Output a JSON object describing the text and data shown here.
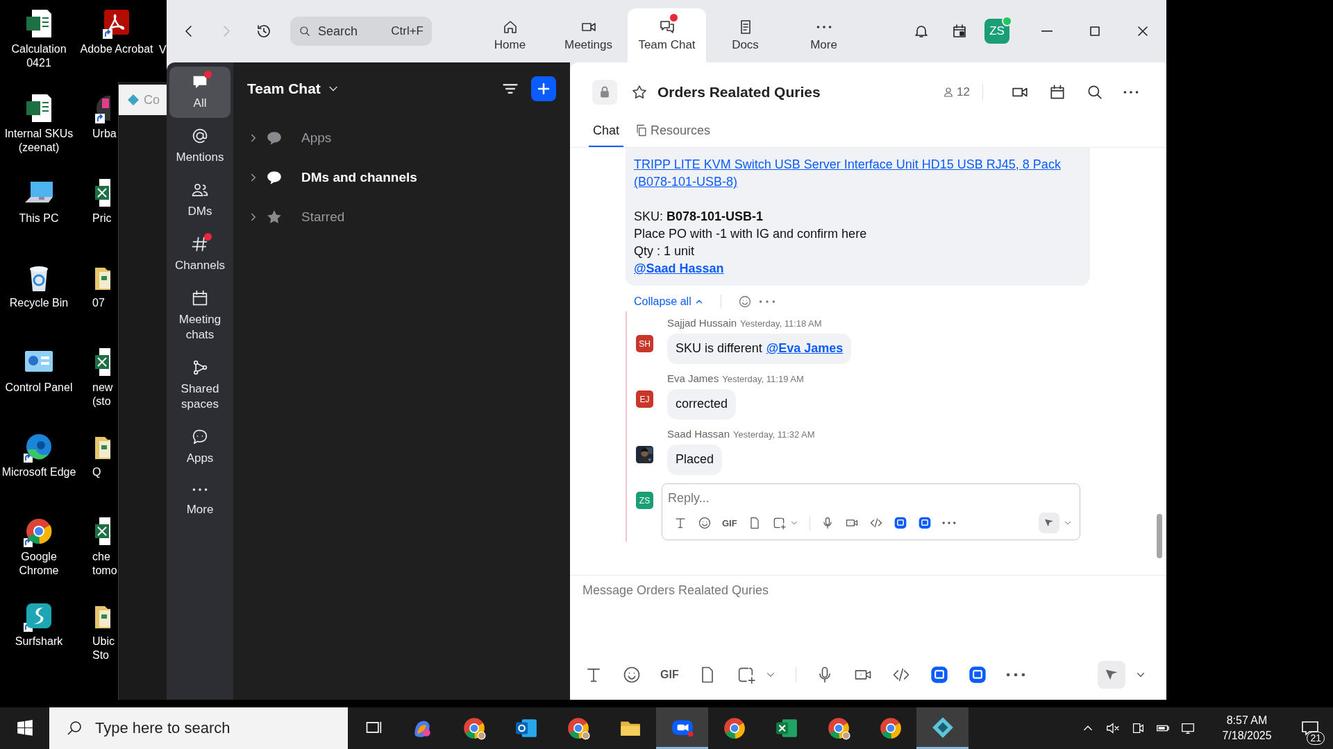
{
  "desktop": {
    "column_1": [
      {
        "label": "Calculation 0421",
        "kind": "spreadsheet",
        "shortcut": false
      },
      {
        "label": "Internal SKUs (zeenat)",
        "kind": "spreadsheet",
        "shortcut": false
      },
      {
        "label": "This PC",
        "kind": "computer",
        "shortcut": false
      },
      {
        "label": "Recycle Bin",
        "kind": "recycle-bin",
        "shortcut": false
      },
      {
        "label": "Control Panel",
        "kind": "control-panel",
        "shortcut": false
      },
      {
        "label": "Microsoft Edge",
        "kind": "edge",
        "shortcut": true
      },
      {
        "label": "Google Chrome",
        "kind": "chrome",
        "shortcut": true
      },
      {
        "label": "Surfshark",
        "kind": "surfshark",
        "shortcut": true
      }
    ],
    "column_2": [
      {
        "label": "Adobe Acrobat",
        "kind": "pdf",
        "shortcut": true,
        "cut": false
      },
      {
        "label": "Urba",
        "kind": "app",
        "shortcut": true,
        "cut": true
      },
      {
        "label": "Pric",
        "kind": "spreadsheet",
        "shortcut": false,
        "cut": true
      },
      {
        "label": "07",
        "kind": "folder",
        "shortcut": false,
        "cut": true
      },
      {
        "label": "new (sto",
        "kind": "spreadsheet",
        "shortcut": false,
        "cut": true
      },
      {
        "label": "Q",
        "kind": "folder",
        "shortcut": false,
        "cut": true
      },
      {
        "label": "che tomo",
        "kind": "spreadsheet",
        "shortcut": false,
        "cut": true
      },
      {
        "label": "Ubic Sto",
        "kind": "folder",
        "shortcut": false,
        "cut": true
      }
    ],
    "column_3_label": "V",
    "background_window": {
      "tab": "Co"
    }
  },
  "zoom": {
    "nav": {
      "forward_disabled": true
    },
    "search": {
      "placeholder": "Search",
      "shortcut": "Ctrl+F"
    },
    "tabs": [
      {
        "label": "Home",
        "selected": false,
        "badge": false
      },
      {
        "label": "Meetings",
        "selected": false,
        "badge": false
      },
      {
        "label": "Team Chat",
        "selected": true,
        "badge": true
      },
      {
        "label": "Docs",
        "selected": false,
        "badge": false
      },
      {
        "label": "More",
        "selected": false,
        "badge": false
      }
    ],
    "user": {
      "initials": "ZS",
      "online": true
    },
    "rail": [
      {
        "label": "All",
        "selected": true,
        "badge": true
      },
      {
        "label": "Mentions",
        "selected": false,
        "badge": false
      },
      {
        "label": "DMs",
        "selected": false,
        "badge": false
      },
      {
        "label": "Channels",
        "selected": false,
        "badge": true
      },
      {
        "label": "Meeting chats",
        "selected": false,
        "badge": false
      },
      {
        "label": "Shared spaces",
        "selected": false,
        "badge": false
      },
      {
        "label": "Apps",
        "selected": false,
        "badge": false
      },
      {
        "label": "More",
        "selected": false,
        "badge": false
      }
    ],
    "sidebar": {
      "title": "Team Chat",
      "sections": [
        {
          "label": "Apps",
          "expanded": false,
          "unread": false
        },
        {
          "label": "DMs and channels",
          "expanded": false,
          "unread": true
        },
        {
          "label": "Starred",
          "expanded": false,
          "unread": false
        }
      ]
    },
    "channel": {
      "title": "Orders Realated Quries",
      "locked": true,
      "starred": false,
      "members": "12",
      "tabs": [
        {
          "label": "Chat",
          "selected": true
        },
        {
          "label": "Resources",
          "selected": false
        }
      ]
    },
    "message": {
      "lines": [
        {
          "kind": "link",
          "text": "TRIPP LITE KVM Switch USB Server Interface Unit HD15 USB RJ45, 8 Pack (B078-101-USB-8)"
        },
        {
          "kind": "text",
          "text": "SKU: **B078-101-USB-1**"
        },
        {
          "kind": "text",
          "text": "Place PO with -1 with IG and confirm here"
        },
        {
          "kind": "text",
          "text": "Qty : 1 unit"
        },
        {
          "kind": "mention",
          "text": "@Saad Hassan"
        }
      ]
    },
    "thread": {
      "collapse_label": "Collapse all",
      "replies": [
        {
          "author": "Sajjad Hussain",
          "time": "Yesterday, 11:18 AM",
          "kind": "initials",
          "initials": "SH",
          "color": "#c9372c",
          "text": "SKU is different",
          "mention": "@Eva James"
        },
        {
          "author": "Eva James",
          "time": "Yesterday, 11:19 AM",
          "kind": "initials",
          "initials": "EJ",
          "color": "#c9372c",
          "text": "corrected"
        },
        {
          "author": "Saad Hassan",
          "time": "Yesterday, 11:32 AM",
          "kind": "picture",
          "text": "Placed"
        }
      ],
      "reply_box": {
        "initials": "ZS",
        "color": "#1a9e75",
        "placeholder": "Reply...",
        "gif_label": "GIF"
      }
    },
    "composer": {
      "placeholder": "Message Orders Realated Quries",
      "gif_label": "GIF"
    }
  },
  "taskbar": {
    "search_placeholder": "Type here to search",
    "apps": [
      {
        "kind": "copilot",
        "highlighted": false
      },
      {
        "kind": "chrome-profile",
        "highlighted": false
      },
      {
        "kind": "outlook",
        "highlighted": false
      },
      {
        "kind": "chrome-profile",
        "highlighted": false
      },
      {
        "kind": "folder",
        "highlighted": false
      },
      {
        "kind": "zoom",
        "highlighted": true
      },
      {
        "kind": "chrome",
        "highlighted": false
      },
      {
        "kind": "excel",
        "highlighted": false
      },
      {
        "kind": "chrome-profile",
        "highlighted": false
      },
      {
        "kind": "chrome",
        "highlighted": false
      },
      {
        "kind": "diamond",
        "highlighted": true
      }
    ],
    "time": "8:57 AM",
    "date": "7/18/2025",
    "notifications": "21"
  }
}
